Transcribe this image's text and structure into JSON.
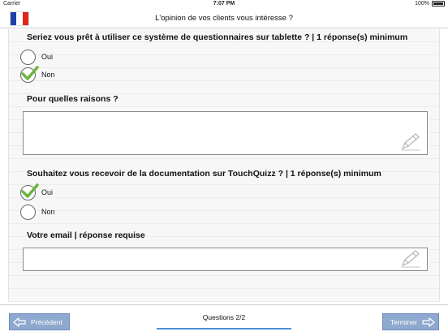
{
  "status": {
    "carrier": "Carrier",
    "time": "7:07 PM",
    "battery": "100%"
  },
  "header": {
    "title": "L'opinion de vos clients vous intéresse ?"
  },
  "questions": [
    {
      "text": "Seriez vous prêt à utiliser ce système de questionnaires sur tablette ? | 1 réponse(s) minimum",
      "options": [
        {
          "label": "Oui",
          "checked": false
        },
        {
          "label": "Non",
          "checked": true
        }
      ]
    },
    {
      "text": "Pour quelles raisons ?"
    },
    {
      "text": "Souhaitez vous recevoir de la documentation sur TouchQuizz ? | 1 réponse(s) minimum",
      "options": [
        {
          "label": "Oui",
          "checked": true
        },
        {
          "label": "Non",
          "checked": false
        }
      ]
    },
    {
      "text": "Votre email | réponse requise"
    }
  ],
  "footer": {
    "prev_label": "Précédent",
    "next_label": "Terminer",
    "pager": "Questions 2/2",
    "progress": 1.0
  },
  "colors": {
    "button": "#8ea9cf",
    "check": "#6db33f",
    "progress": "#4a8fd8"
  }
}
